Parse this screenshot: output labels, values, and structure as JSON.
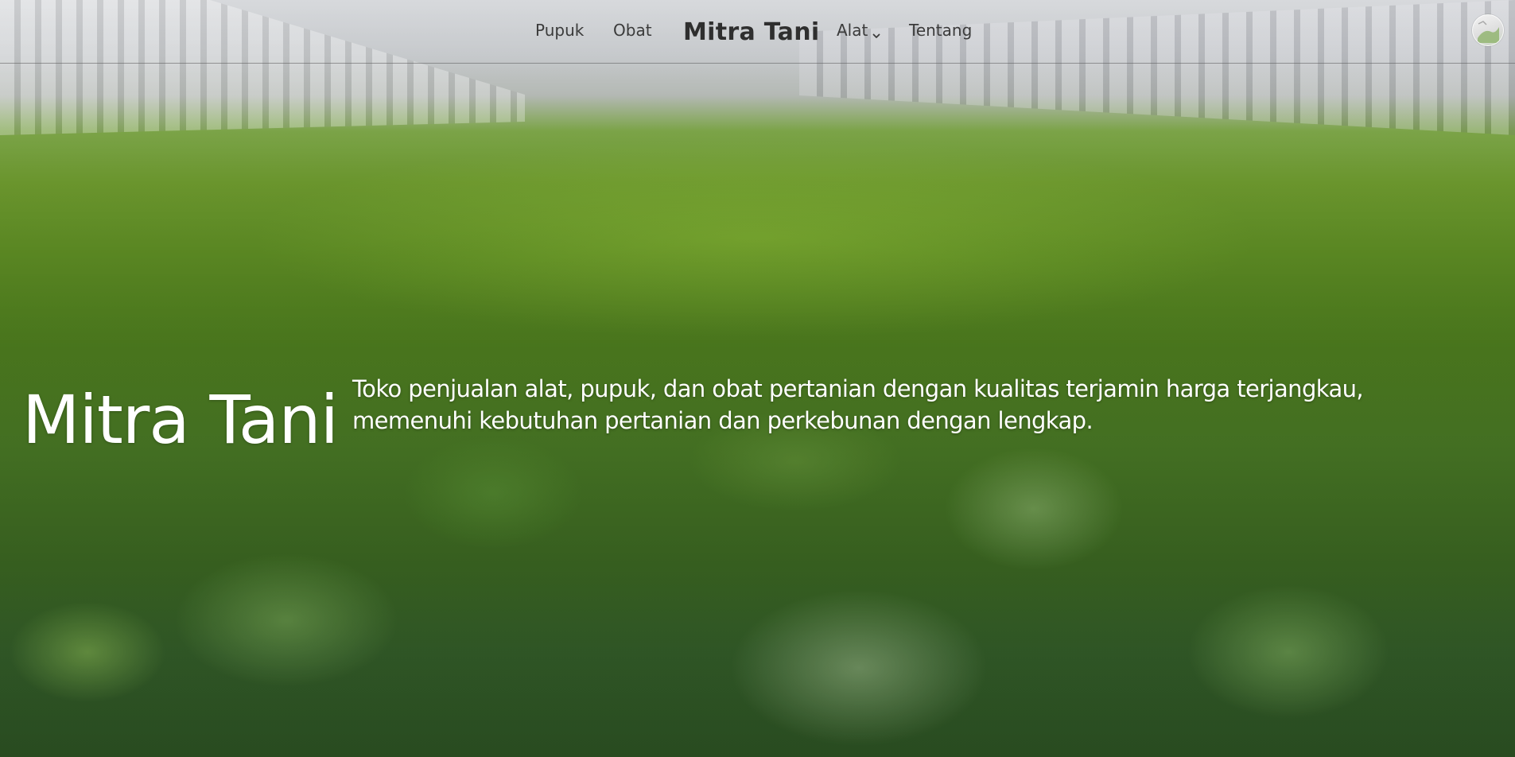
{
  "nav": {
    "links": {
      "pupuk": "Pupuk",
      "obat": "Obat",
      "alat": "Alat",
      "tentang": "Tentang"
    },
    "brand": "Mitra Tani",
    "alat_icon": "chevron-down-icon"
  },
  "user": {
    "avatar_icon": "avatar-image"
  },
  "hero": {
    "title": "Mitra Tani",
    "description_line1": "Toko penjualan alat, pupuk, dan obat pertanian dengan kualitas terjamin harga terjangkau,",
    "description_line2": "memenuhi kebutuhan pertanian dan perkebunan dengan lengkap."
  },
  "colors": {
    "nav_text": "#3b3b3b",
    "brand_text": "#2f2f2f",
    "hero_text": "#ffffff",
    "leaf_green": "#4d7d24"
  }
}
